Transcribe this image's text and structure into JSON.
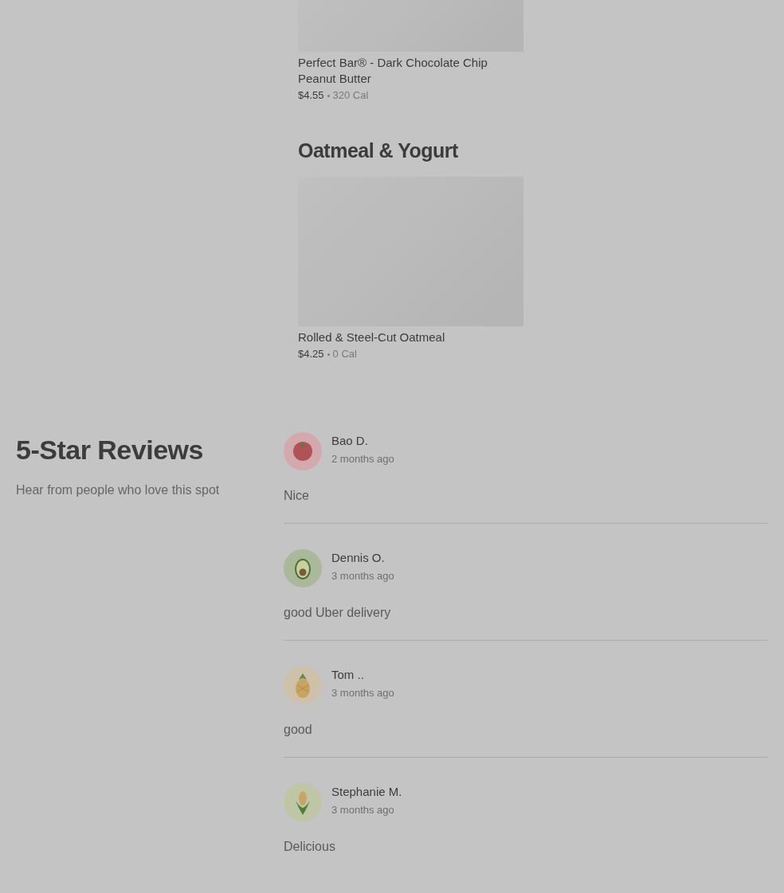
{
  "menu_sections": [
    {
      "items": [
        {
          "name": "Perfect Bar® - Dark Chocolate Chip Peanut Butter",
          "price": "$4.55",
          "calories": "320 Cal"
        }
      ]
    },
    {
      "heading": "Oatmeal & Yogurt",
      "items": [
        {
          "name": "Rolled & Steel-Cut Oatmeal",
          "price": "$4.25",
          "calories": "0 Cal"
        }
      ]
    }
  ],
  "reviews_section": {
    "title": "5-Star Reviews",
    "subtitle": "Hear from people who love this spot"
  },
  "reviews": [
    {
      "kind": "tomato",
      "name": "Bao D.",
      "time": "2 months ago",
      "text": "Nice"
    },
    {
      "kind": "avocado",
      "name": "Dennis O.",
      "time": "3 months ago",
      "text": "good Uber delivery"
    },
    {
      "kind": "pineapple",
      "name": "Tom ..",
      "time": "3 months ago",
      "text": "good"
    },
    {
      "kind": "corn",
      "name": "Stephanie M.",
      "time": "3 months ago",
      "text": "Delicious"
    }
  ]
}
